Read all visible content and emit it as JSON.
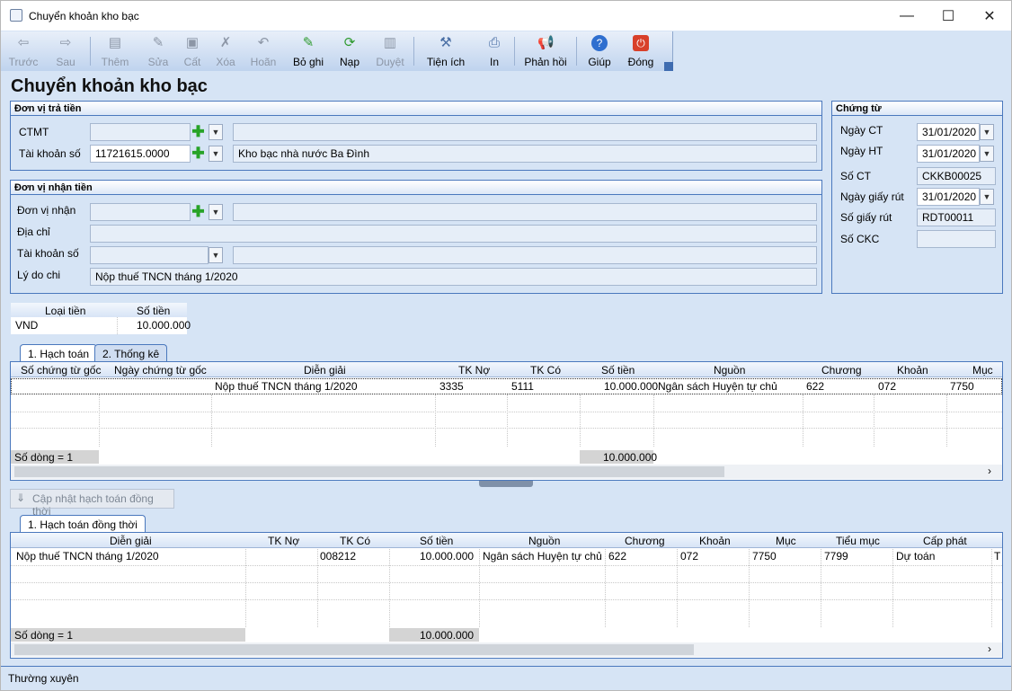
{
  "window": {
    "title": "Chuyển khoản kho bạc"
  },
  "toolbar": {
    "buttons": [
      {
        "label": "Trước",
        "icon": "arrow-left-icon"
      },
      {
        "label": "Sau",
        "icon": "arrow-right-icon"
      },
      {
        "label": "Thêm",
        "icon": "add-doc-icon"
      },
      {
        "label": "Sửa",
        "icon": "edit-icon"
      },
      {
        "label": "Cất",
        "icon": "save-icon"
      },
      {
        "label": "Xóa",
        "icon": "delete-icon"
      },
      {
        "label": "Hoãn",
        "icon": "undo-icon"
      },
      {
        "label": "Bỏ ghi",
        "icon": "unpost-icon"
      },
      {
        "label": "Nạp",
        "icon": "reload-icon"
      },
      {
        "label": "Duyệt",
        "icon": "approve-icon"
      },
      {
        "label": "Tiện ích",
        "icon": "tools-icon"
      },
      {
        "label": "In",
        "icon": "print-icon"
      },
      {
        "label": "Phản hồi",
        "icon": "feedback-icon"
      },
      {
        "label": "Giúp",
        "icon": "help-icon"
      },
      {
        "label": "Đóng",
        "icon": "close-power-icon"
      }
    ]
  },
  "page": {
    "title": "Chuyển khoản kho bạc"
  },
  "payer": {
    "header": "Đơn vị trả tiền",
    "ctmt_label": "CTMT",
    "ctmt_value": "",
    "account_label": "Tài khoản số",
    "account_value": "11721615.0000",
    "account_name": "Kho bạc nhà nước Ba Đình"
  },
  "payee": {
    "header": "Đơn vị nhận tiền",
    "unit_label": "Đơn vị nhận",
    "address_label": "Địa chỉ",
    "account_label": "Tài khoản số",
    "reason_label": "Lý do chi",
    "reason_value": "Nộp thuế TNCN tháng 1/2020"
  },
  "voucher": {
    "header": "Chứng từ",
    "fields": [
      {
        "label": "Ngày CT",
        "value": "31/01/2020"
      },
      {
        "label": "Ngày HT",
        "value": "31/01/2020"
      },
      {
        "label": "Số CT",
        "value": "CKKB00025"
      },
      {
        "label": "Ngày giấy rút",
        "value": "31/01/2020"
      },
      {
        "label": "Số giấy rút",
        "value": "RDT00011"
      },
      {
        "label": "Số CKC",
        "value": ""
      }
    ]
  },
  "currency": {
    "headers": [
      "Loại tiền",
      "Số tiền"
    ],
    "row": [
      "VND",
      "10.000.000"
    ]
  },
  "tabs1": [
    "1. Hạch toán",
    "2. Thống kê"
  ],
  "grid1": {
    "headers": [
      "Số chứng từ gốc",
      "Ngày chứng từ gốc",
      "Diễn giải",
      "TK Nợ",
      "TK Có",
      "Số tiền",
      "Nguồn",
      "Chương",
      "Khoản",
      "Mục"
    ],
    "row": [
      "",
      "",
      "Nộp thuế TNCN tháng 1/2020",
      "3335",
      "5111",
      "10.000.000",
      "Ngân sách Huyện tự chủ",
      "622",
      "072",
      "7750"
    ],
    "count": "Số dòng = 1",
    "total": "10.000.000"
  },
  "update_button": "Cập nhật hạch toán đồng thời",
  "tabs2": [
    "1. Hạch toán đồng thời"
  ],
  "grid2": {
    "headers": [
      "Diễn giải",
      "TK Nợ",
      "TK Có",
      "Số tiền",
      "Nguồn",
      "Chương",
      "Khoản",
      "Mục",
      "Tiểu mục",
      "Cấp phát",
      "T"
    ],
    "row": [
      "Nộp thuế TNCN tháng 1/2020",
      "",
      "008212",
      "10.000.000",
      "Ngân sách Huyện tự chủ",
      "622",
      "072",
      "7750",
      "7799",
      "Dự toán",
      "T"
    ],
    "count": "Số dòng = 1",
    "total": "10.000.000"
  },
  "status": {
    "text": "Thường xuyên"
  }
}
